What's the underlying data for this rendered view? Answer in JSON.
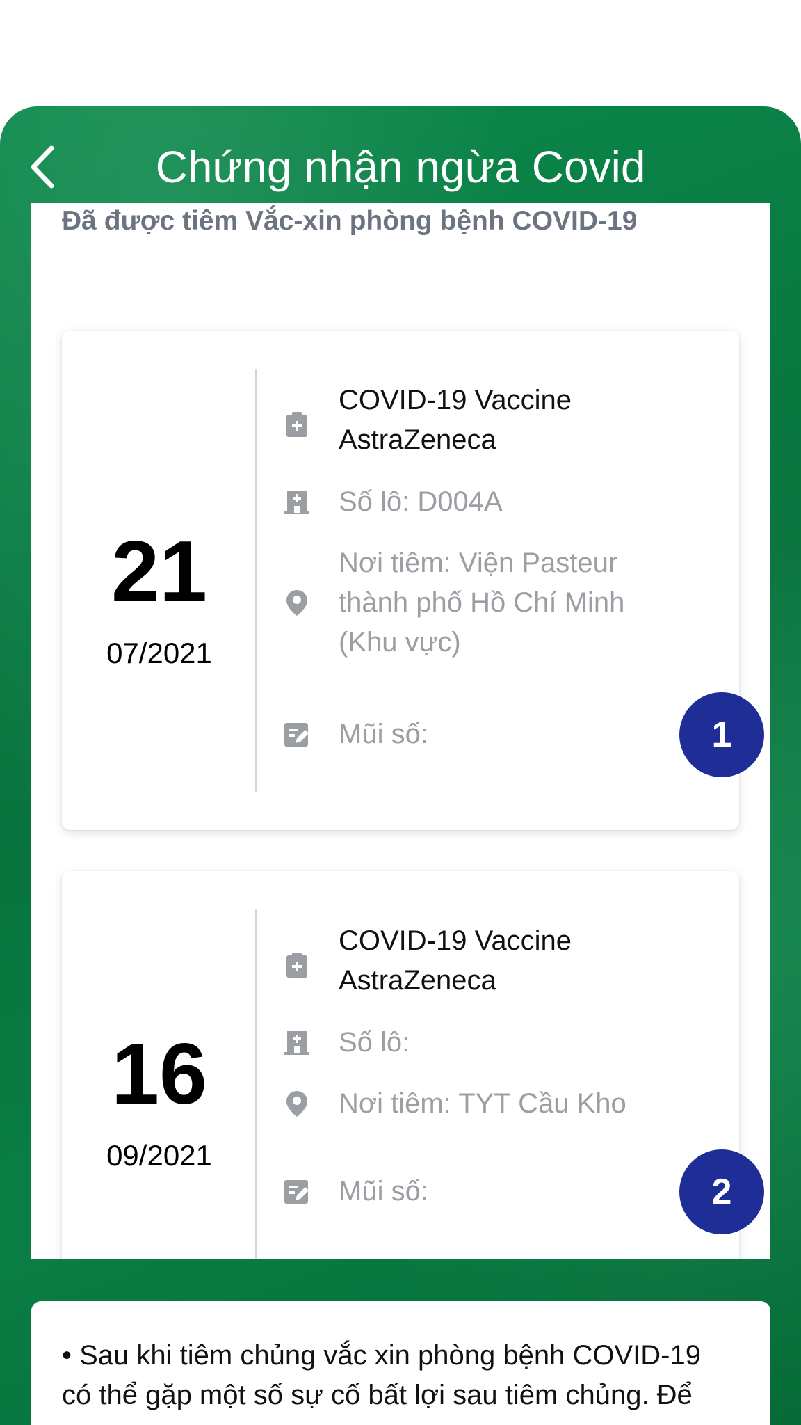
{
  "header": {
    "title": "Chứng nhận ngừa Covid",
    "back_icon": "chevron-left-icon"
  },
  "subtitle": "Đã được tiêm Vắc-xin phòng bệnh COVID-19",
  "colors": {
    "header_green": "#0a7f45",
    "dose_badge_blue": "#1f2d96",
    "muted_text": "#9b9fa4"
  },
  "vaccinations": [
    {
      "day": "21",
      "month_year": "07/2021",
      "vaccine_name_line1": "COVID-19 Vaccine",
      "vaccine_name_line2": "AstraZeneca",
      "lot": "Số lô: D004A",
      "location_line1": "Nơi tiêm: Viện Pasteur",
      "location_line2": "thành phố Hồ Chí Minh",
      "location_line3": "(Khu vực)",
      "dose_label": "Mũi số:",
      "dose_number": "1"
    },
    {
      "day": "16",
      "month_year": "09/2021",
      "vaccine_name_line1": "COVID-19 Vaccine",
      "vaccine_name_line2": "AstraZeneca",
      "lot": "Số lô:",
      "location_line1": "Nơi tiêm: TYT Cầu Kho",
      "dose_label": "Mũi số:",
      "dose_number": "2"
    }
  ],
  "note": {
    "line1": "• Sau khi tiêm chủng vắc xin phòng bệnh COVID-19",
    "line2": "có thể gặp một số sự cố bất lợi sau tiêm chủng. Để"
  }
}
